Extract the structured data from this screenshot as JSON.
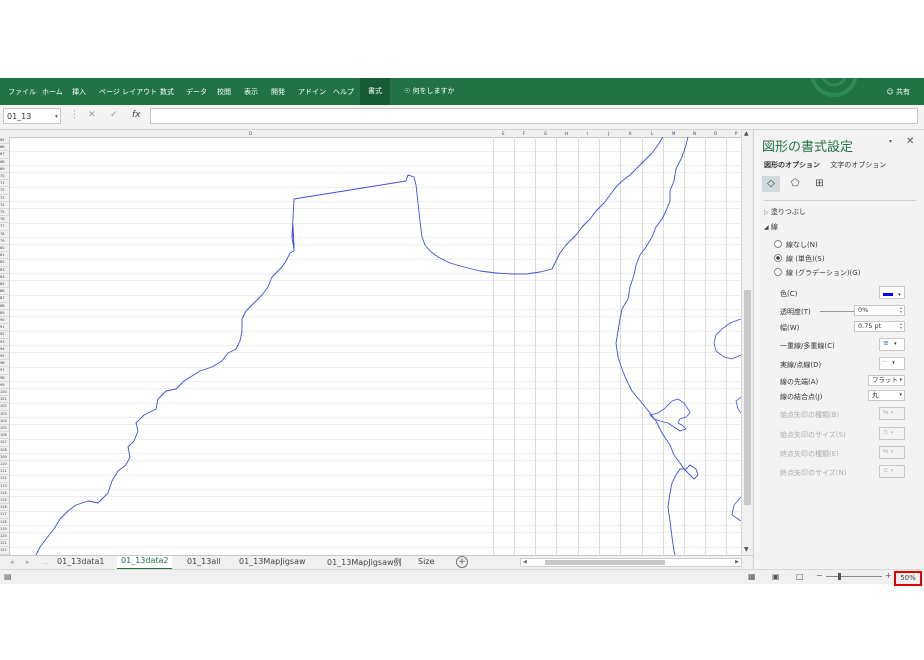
{
  "ribbon": {
    "tabs": [
      "ファイル",
      "ホーム",
      "挿入",
      "ページ レイアウト",
      "数式",
      "データ",
      "校閲",
      "表示",
      "開発",
      "アドイン",
      "ヘルプ",
      "書式"
    ],
    "active_tab": "書式",
    "tell_me": "何をしますか",
    "share": "共有"
  },
  "formula_bar": {
    "name_box": "01_13",
    "fx": "fx",
    "formula": ""
  },
  "sheet": {
    "column_headers": [
      "D",
      "E",
      "F",
      "G",
      "H",
      "I",
      "J",
      "K",
      "L",
      "M",
      "N",
      "O",
      "P"
    ],
    "row_start": 65,
    "row_end": 122
  },
  "sheet_tabs": {
    "tabs": [
      "01_13data1",
      "01_13data2",
      "01_13all",
      "01_13MapJigsaw",
      "01_13MapJigsaw例",
      "Size"
    ],
    "active": "01_13data2"
  },
  "status_bar": {
    "zoom": "50%"
  },
  "format_pane": {
    "title": "図形の書式設定",
    "tabs": [
      "図形のオプション",
      "文字のオプション"
    ],
    "fill_section": "塗りつぶし",
    "line_section": "線",
    "line_options": [
      "線なし(N)",
      "線 (単色)(S)",
      "線 (グラデーション)(G)"
    ],
    "selected_line_option": 1,
    "rows": {
      "color": "色(C)",
      "transparency": "透明度(T)",
      "transparency_value": "0%",
      "width": "幅(W)",
      "width_value": "0.75 pt",
      "compound": "一重線/多重線(C)",
      "dash": "実線/点線(D)",
      "cap": "線の先端(A)",
      "cap_value": "フラット",
      "join": "線の結合点(J)",
      "join_value": "丸",
      "begin_arrow_type": "始点矢印の種類(B)",
      "begin_arrow_size": "始点矢印のサイズ(S)",
      "end_arrow_type": "終点矢印の種類(E)",
      "end_arrow_size": "終点矢印のサイズ(N)"
    },
    "line_color": "#0000ff"
  },
  "colors": {
    "ribbon": "#217346",
    "map_line": "#3b4fe0",
    "zoom_highlight": "#e00000"
  }
}
